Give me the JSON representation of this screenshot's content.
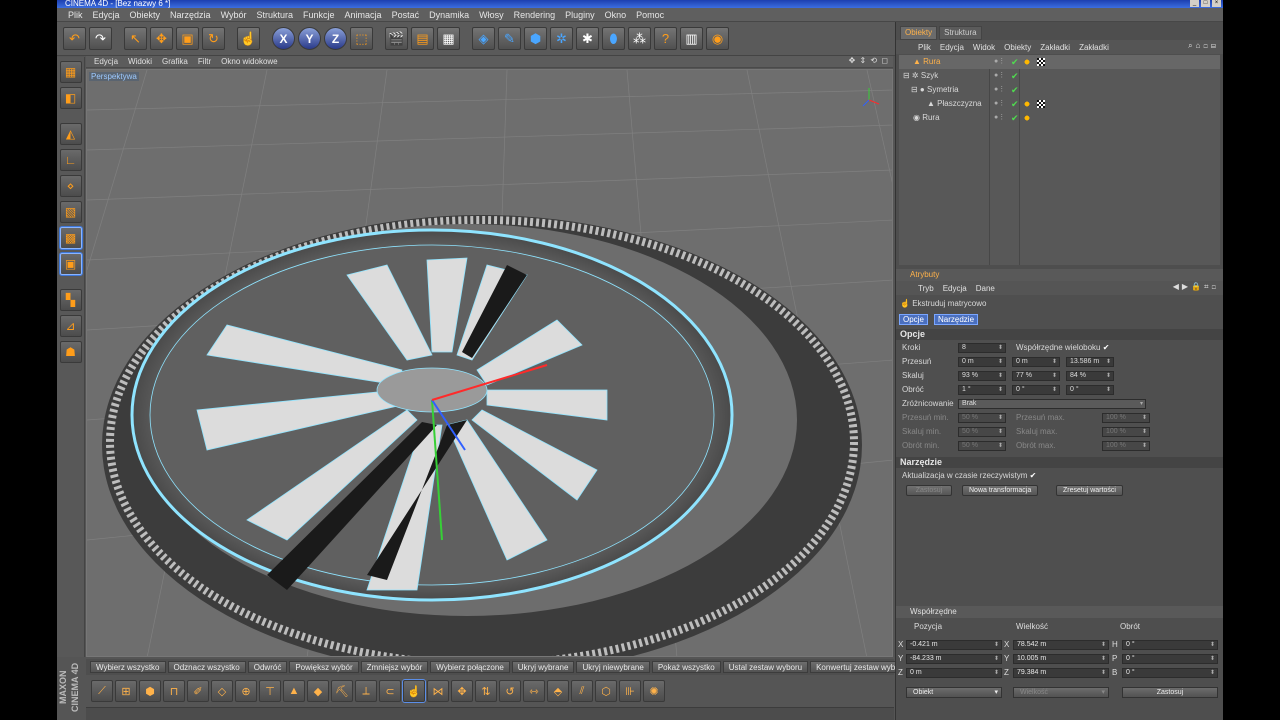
{
  "window": {
    "title": "CINEMA 4D - [Bez nazwy 6 *]"
  },
  "menu": [
    "Plik",
    "Edycja",
    "Obiekty",
    "Narzędzia",
    "Wybór",
    "Struktura",
    "Funkcje",
    "Animacja",
    "Postać",
    "Dynamika",
    "Włosy",
    "Rendering",
    "Pluginy",
    "Okno",
    "Pomoc"
  ],
  "viewport": {
    "menu": [
      "Edycja",
      "Widoki",
      "Grafika",
      "Filtr",
      "Okno widokowe"
    ],
    "label": "Perspektywa"
  },
  "right_tabs": {
    "objects": "Obiekty",
    "structure": "Struktura"
  },
  "object_menu": [
    "Plik",
    "Edycja",
    "Widok",
    "Obiekty",
    "Zakładki",
    "Zakładki"
  ],
  "objects": [
    {
      "name": "Rura",
      "selected": true
    },
    {
      "name": "Szyk"
    },
    {
      "name": "Symetria"
    },
    {
      "name": "Płaszczyzna"
    },
    {
      "name": "Rura"
    }
  ],
  "attributes": {
    "header": "Atrybuty",
    "menu": [
      "Tryb",
      "Edycja",
      "Dane"
    ],
    "tool_name": "Ekstruduj matrycowo",
    "tabs": [
      "Opcje",
      "Narzędzie"
    ],
    "section_opcje": "Opcje",
    "kroki_label": "Kroki",
    "kroki_value": "8",
    "wsp_label": "Współrzędne wieloboku",
    "przesun_label": "Przesuń",
    "przesun": [
      "0 m",
      "0 m",
      "13.586 m"
    ],
    "skaluj_label": "Skaluj",
    "skaluj": [
      "93 %",
      "77 %",
      "84 %"
    ],
    "obroc_label": "Obróć",
    "obroc": [
      "1 °",
      "0 °",
      "0 °"
    ],
    "zroz_label": "Zróżnicowanie",
    "zroz_value": "Brak",
    "przesun_min_label": "Przesuń min.",
    "przesun_min": "50 %",
    "przesun_max_label": "Przesuń max.",
    "przesun_max": "100 %",
    "skaluj_min_label": "Skaluj min.",
    "skaluj_min": "50 %",
    "skaluj_max_label": "Skaluj max.",
    "skaluj_max": "100 %",
    "obroc_min_label": "Obrót min.",
    "obroc_min": "50 %",
    "obroc_max_label": "Obrót max.",
    "obroc_max": "100 %",
    "section_narzedzie": "Narzędzie",
    "realtime_label": "Aktualizacja w czasie rzeczywistym",
    "btn_apply": "Zastosuj",
    "btn_new": "Nowa transformacja",
    "btn_reset": "Zresetuj wartości"
  },
  "coords": {
    "header": "Współrzędne",
    "col_pos": "Pozycja",
    "col_size": "Wielkość",
    "col_rot": "Obrót",
    "rows": [
      {
        "a": "X",
        "pos": "-0.421 m",
        "sa": "X",
        "size": "78.542 m",
        "ra": "H",
        "rot": "0 °"
      },
      {
        "a": "Y",
        "pos": "-84.233 m",
        "sa": "Y",
        "size": "10.005 m",
        "ra": "P",
        "rot": "0 °"
      },
      {
        "a": "Z",
        "pos": "0 m",
        "sa": "Z",
        "size": "79.384 m",
        "ra": "B",
        "rot": "0 °"
      }
    ],
    "mode_select": "Obiekt",
    "size_select": "Wielkość",
    "apply_btn": "Zastosuj"
  },
  "commands": [
    "Wybierz wszystko",
    "Odznacz wszystko",
    "Odwróć",
    "Powiększ wybór",
    "Zmniejsz wybór",
    "Wybierz połączone",
    "Ukryj wybrane",
    "Ukryj niewybrane",
    "Pokaż wszystko",
    "Ustal zestaw wyboru",
    "Konwertuj zestaw wyboru"
  ],
  "brand": "MAXON CINEMA 4D",
  "accent_color": "#ffb24a",
  "selection_color": "#8fe4ff"
}
